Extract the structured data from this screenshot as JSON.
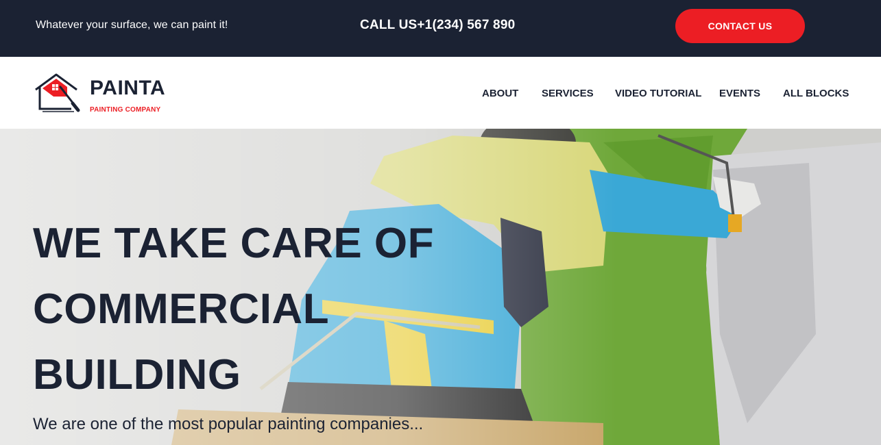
{
  "topbar": {
    "tagline": "Whatever your surface, we can paint it!",
    "phone": "CALL US+1(234) 567 890",
    "contact_label": "CONTACT US"
  },
  "logo": {
    "name": "PAINTA",
    "subtitle": "PAINTING COMPANY",
    "icon": "house-paint-roller-icon"
  },
  "nav": {
    "items": [
      {
        "label": "ABOUT"
      },
      {
        "label": "SERVICES"
      },
      {
        "label": "VIDEO TUTORIAL"
      },
      {
        "label": "EVENTS"
      },
      {
        "label": "ALL BLOCKS"
      }
    ]
  },
  "hero": {
    "title_lines": [
      "WE TAKE CARE OF",
      "COMMERCIAL",
      "BUILDING"
    ],
    "subtitle": "We are one of the most popular painting companies..."
  },
  "colors": {
    "dark": "#1b2233",
    "accent": "#ec1e24",
    "white": "#ffffff"
  }
}
